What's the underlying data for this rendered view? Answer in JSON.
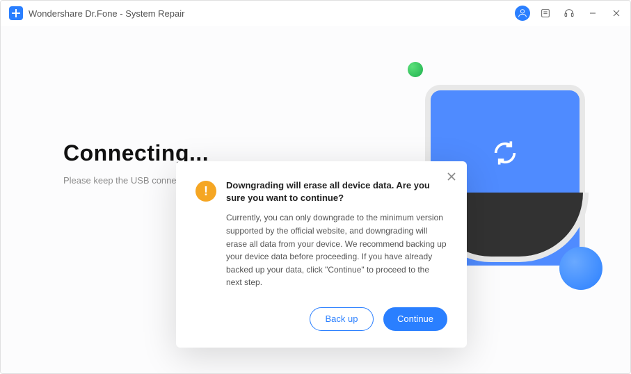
{
  "titlebar": {
    "title": "Wondershare Dr.Fone - System Repair"
  },
  "hero": {
    "heading": "Connecting...",
    "subtext": "Please keep the USB connection"
  },
  "modal": {
    "title": "Downgrading will erase all device data. Are you sure you want to continue?",
    "description": "Currently, you can only downgrade to the minimum version supported by the official website, and downgrading will erase all data from your device. We recommend backing up your device data before proceeding. If you have already backed up your data, click \"Continue\" to proceed to the next step.",
    "backup_label": "Back up",
    "continue_label": "Continue"
  }
}
